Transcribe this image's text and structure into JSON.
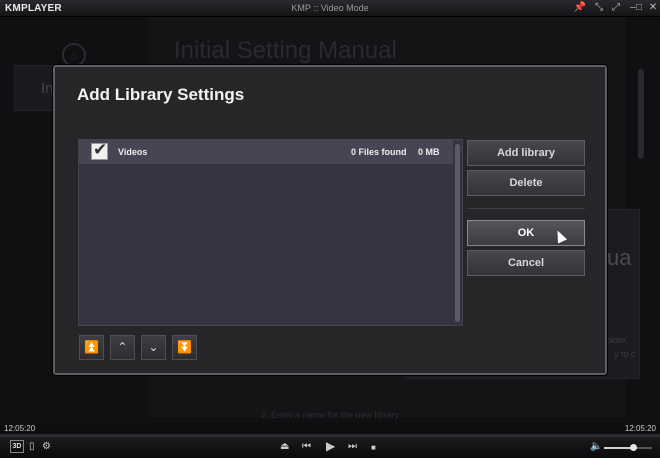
{
  "window": {
    "logo": "KMPLAYER",
    "title": "KMP :: Video Mode",
    "controls": {
      "pin": "📌",
      "shrink": "⤡",
      "expand": "⤢",
      "minimize": "–",
      "maximize": "□",
      "close": "✕"
    }
  },
  "background": {
    "title": "Initial Setting Manual",
    "left_tab": "In",
    "right_fragment": "ua",
    "small_text1": "older,",
    "small_text2": "y to c",
    "hint": "2. Enter a name for the new library",
    "home_icon": "home-icon"
  },
  "dialog": {
    "title": "Add Library Settings",
    "libraries": [
      {
        "name": "Videos",
        "files": "0 Files found",
        "size": "0 MB",
        "checked": true
      }
    ],
    "buttons": {
      "add": "Add library",
      "delete": "Delete",
      "ok": "OK",
      "cancel": "Cancel"
    },
    "move_buttons": {
      "top": "⏫",
      "up": "⌃",
      "down": "⌄",
      "bottom": "⏬"
    }
  },
  "player": {
    "time_left": "12:05:20",
    "time_right": "12:05:20",
    "badge_3d": "3D",
    "icons": {
      "playlist": "▯",
      "settings": "⚙",
      "eject": "⏏",
      "prev": "⏮",
      "play": "▶",
      "next": "⏭",
      "stop": "■",
      "volume": "🔈"
    },
    "volume": 0.6
  },
  "colors": {
    "accent": "#5f5f63",
    "dialog_bg": "#262629",
    "list_bg": "#353541"
  }
}
